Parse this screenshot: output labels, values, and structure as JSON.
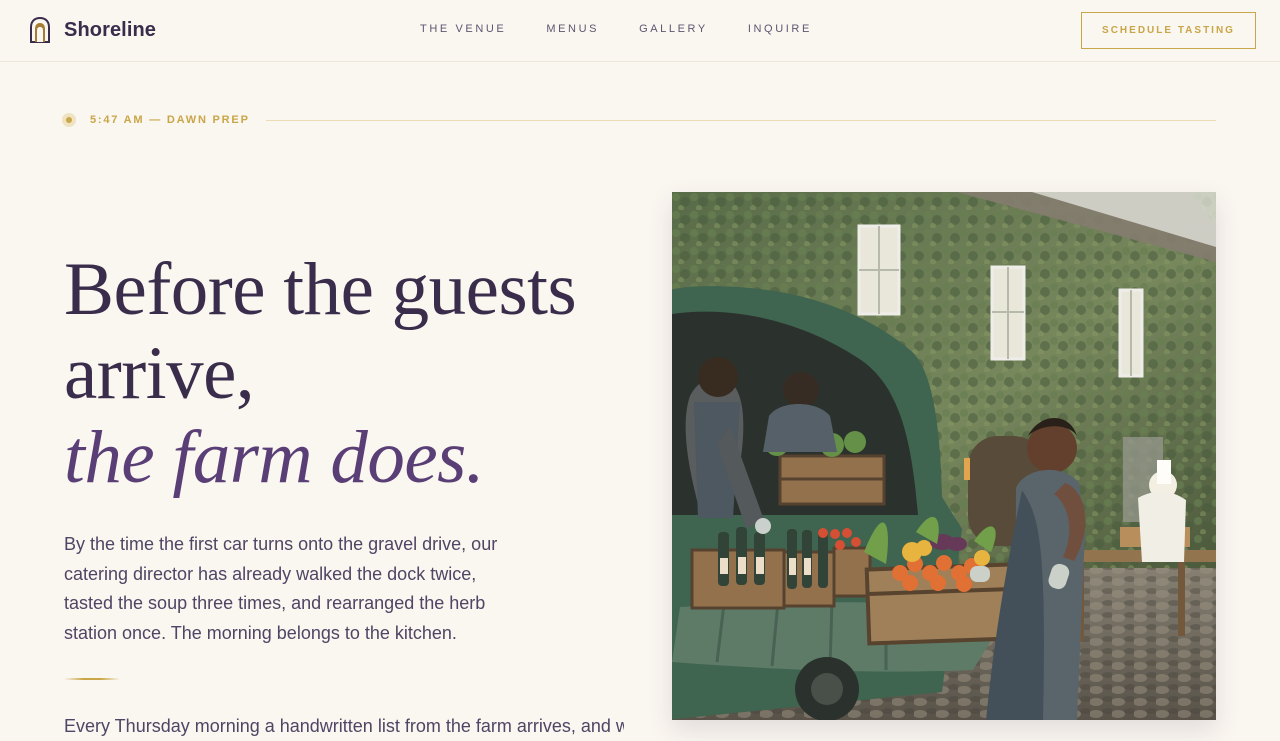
{
  "brand": {
    "name": "Shoreline",
    "icon": "arch-logo-icon"
  },
  "nav": {
    "items": [
      {
        "label": "THE VENUE"
      },
      {
        "label": "MENUS"
      },
      {
        "label": "GALLERY"
      },
      {
        "label": "INQUIRE"
      }
    ],
    "cta_label": "SCHEDULE TASTING"
  },
  "timeline": {
    "label": "5:47 AM — DAWN PREP"
  },
  "hero": {
    "headline_line1": "Before the guests",
    "headline_line2": "arrive,",
    "headline_accent": "the farm does.",
    "lead": "By the time the first car turns onto the gravel drive, our catering director has already walked the dock twice, tasted the soup three times, and rearranged the herb station once. The morning belongs to the kitchen.",
    "following_text": "Every Thursday morning a handwritten list from the farm arrives, and whatever looks best that week goes"
  },
  "photo": {
    "icon": "farm-delivery-photo"
  },
  "colors": {
    "background": "#faf6f0",
    "text": "#3a2d4b",
    "accent_purple": "#5a3f77",
    "accent_gold": "#c9a647"
  }
}
